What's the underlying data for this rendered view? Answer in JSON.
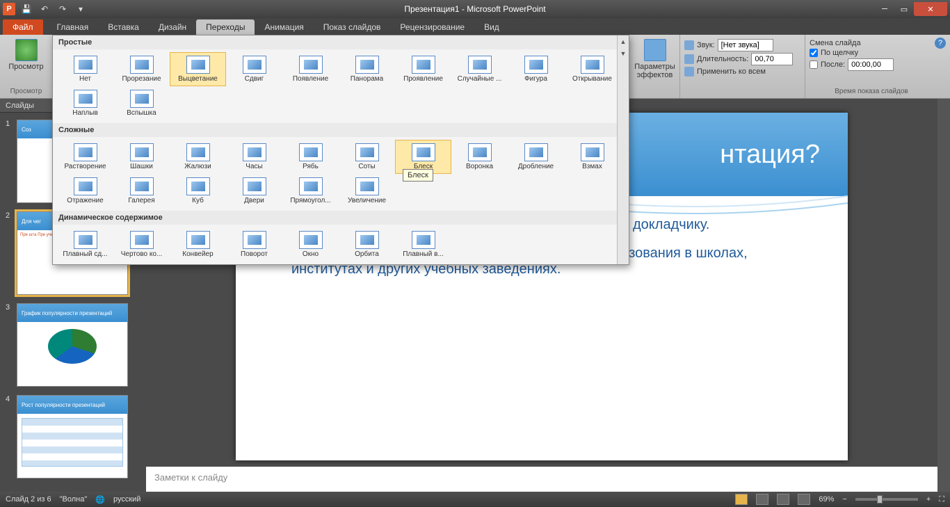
{
  "title": "Презентация1 - Microsoft PowerPoint",
  "app_letter": "P",
  "qat": {
    "save": "💾",
    "undo": "↶",
    "redo": "↷"
  },
  "tabs": {
    "file": "Файл",
    "items": [
      "Главная",
      "Вставка",
      "Дизайн",
      "Переходы",
      "Анимация",
      "Показ слайдов",
      "Рецензирование",
      "Вид"
    ],
    "active_index": 3
  },
  "ribbon": {
    "preview_btn": "Просмотр",
    "preview_group": "Просмотр",
    "options_btn": "Параметры\nэффектов",
    "sound_label": "Звук:",
    "sound_value": "[Нет звука]",
    "duration_label": "Длительность:",
    "duration_value": "00,70",
    "apply_all": "Применить ко всем",
    "advance_group_title": "Смена слайда",
    "on_click": "По щелчку",
    "after_label": "После:",
    "after_value": "00:00,00",
    "timing_group": "Время показа слайдов"
  },
  "gallery": {
    "sections": [
      {
        "title": "Простые",
        "items": [
          "Нет",
          "Прорезание",
          "Выцветание",
          "Сдвиг",
          "Появление",
          "Панорама",
          "Проявление",
          "Случайные ...",
          "Фигура",
          "Открывание",
          "Наплыв",
          "Вспышка"
        ],
        "selected": 2
      },
      {
        "title": "Сложные",
        "items": [
          "Растворение",
          "Шашки",
          "Жалюзи",
          "Часы",
          "Рябь",
          "Соты",
          "Блеск",
          "Воронка",
          "Дробление",
          "Взмах",
          "Отражение",
          "Галерея",
          "Куб",
          "Двери",
          "Прямоугол...",
          "Увеличение"
        ],
        "hover": 6
      },
      {
        "title": "Динамическое содержимое",
        "items": [
          "Плавный сд...",
          "Чертово ко...",
          "Конвейер",
          "Поворот",
          "Окно",
          "Орбита",
          "Плавный в..."
        ]
      }
    ],
    "tooltip": "Блеск"
  },
  "slides_panel": {
    "header": "Слайды",
    "thumbs": [
      {
        "num": "1",
        "title": "Соз"
      },
      {
        "num": "2",
        "title": "Для чег",
        "body": "Пре\nшта\nПре\nучеб",
        "selected": true,
        "star": true
      },
      {
        "num": "3",
        "title": "График популярности презентаций",
        "chart": true
      },
      {
        "num": "4",
        "title": "Рост популярности презентаций",
        "table": true
      }
    ]
  },
  "slide": {
    "title_fragment": "нтация?",
    "bullets": [
      "диторией раскрываемой темы и служит шпаргалкой докладчику.",
      "Применяются не только в бизнесе, но и сфере образования в школах, институтах и других учебных заведениях."
    ]
  },
  "notes_placeholder": "Заметки к слайду",
  "status": {
    "slide_info": "Слайд 2 из 6",
    "theme": "\"Волна\"",
    "lang": "русский",
    "zoom": "69%"
  }
}
